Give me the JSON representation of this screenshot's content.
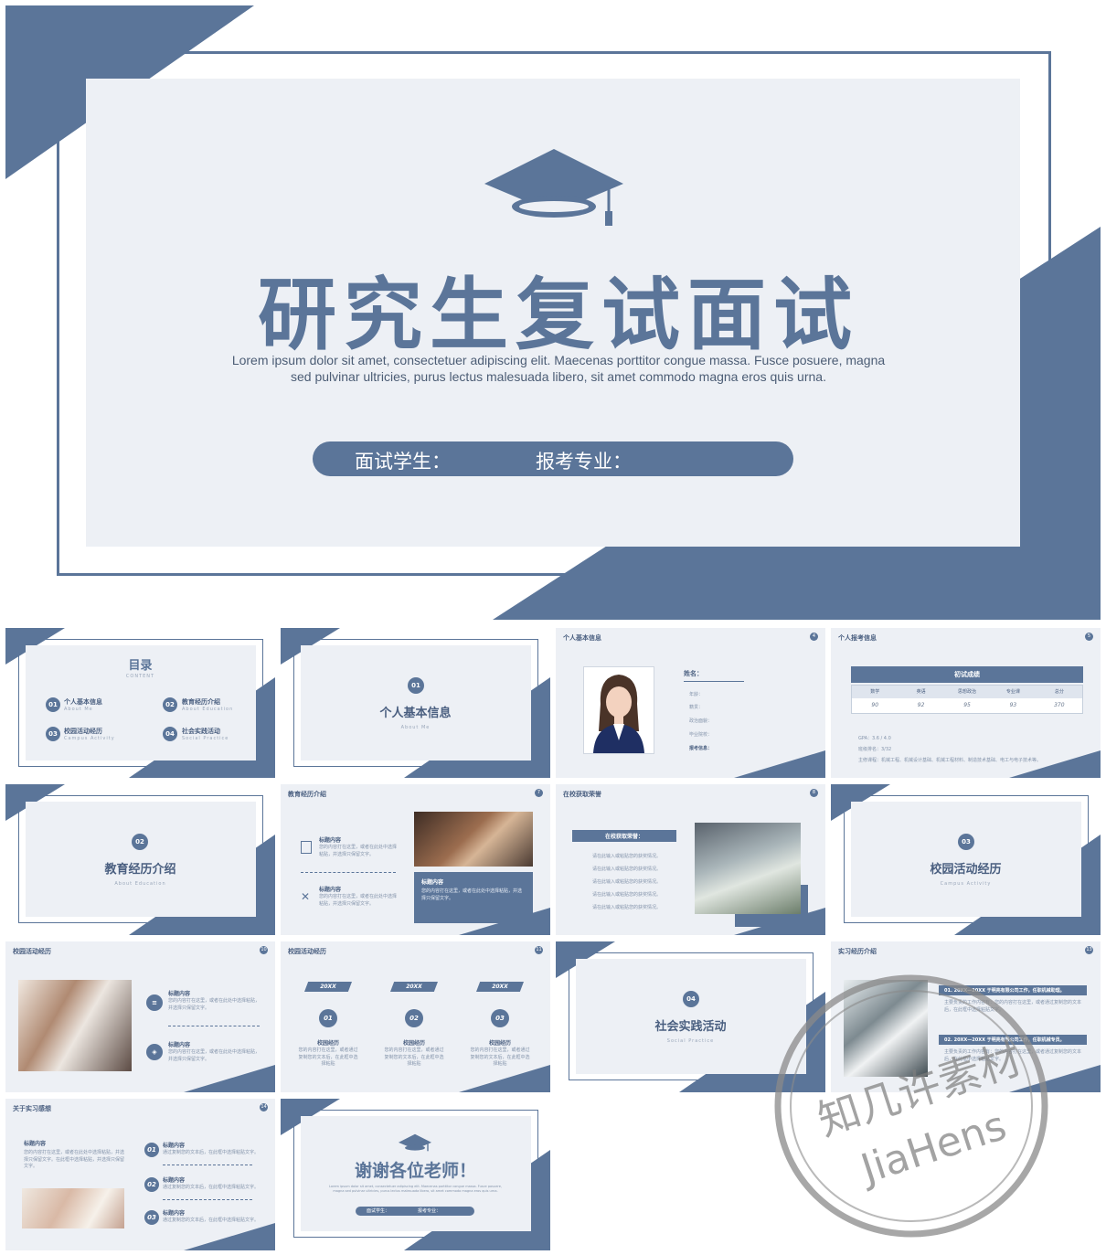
{
  "main": {
    "title": "研究生复试面试",
    "subtitle_line1": "Lorem ipsum dolor sit amet, consectetuer adipiscing elit. Maecenas porttitor congue massa. Fusce posuere, magna",
    "subtitle_line2": "sed pulvinar ultricies, purus lectus malesuada libero, sit amet commodo magna eros quis urna.",
    "student_label": "面试学生：",
    "major_label": "报考专业："
  },
  "toc": {
    "title": "目录",
    "subtitle": "CONTENT",
    "items": [
      {
        "num": "01",
        "label": "个人基本信息",
        "en": "About Me"
      },
      {
        "num": "02",
        "label": "教育经历介绍",
        "en": "About Education"
      },
      {
        "num": "03",
        "label": "校园活动经历",
        "en": "Campus Activity"
      },
      {
        "num": "04",
        "label": "社会实践活动",
        "en": "Social Practice"
      }
    ]
  },
  "section1": {
    "num": "01",
    "title": "个人基本信息",
    "en": "About Me"
  },
  "section2": {
    "num": "02",
    "title": "教育经历介绍",
    "en": "About Education"
  },
  "section3": {
    "num": "03",
    "title": "校园活动经历",
    "en": "Campus Activity"
  },
  "section4": {
    "num": "04",
    "title": "社会实践活动",
    "en": "Social Practice"
  },
  "info": {
    "header": "个人基本信息",
    "page": "4",
    "name_label": "姓名：",
    "fields": [
      "年龄：",
      "籍贯：",
      "政治面貌：",
      "毕业院校：",
      "报考信息："
    ]
  },
  "scores": {
    "header": "个人报考信息",
    "page": "5",
    "table_title": "初试成绩",
    "columns": [
      "数学",
      "英语",
      "思想政治",
      "专业课",
      "总分"
    ],
    "values": [
      "90",
      "92",
      "95",
      "93",
      "370"
    ],
    "notes": [
      "GPA：3.6 / 4.0",
      "班级排名：3/32",
      "主修课程：机械工程、机械设计基础、机械工程材料、制造技术基础、电工与电子技术等。"
    ]
  },
  "edu": {
    "header": "教育经历介绍",
    "page": "7",
    "item_title": "标题内容",
    "item_text": "您的内容打在这里，或者在此处中选择粘贴，并选择只保留文字。"
  },
  "honors": {
    "header": "在校获取荣誉",
    "page": "8",
    "box_title": "在校获取荣誉：",
    "items": [
      "请在此输入或粘贴您的获奖情况。",
      "请在此输入或粘贴您的获奖情况。",
      "请在此输入或粘贴您的获奖情况。",
      "请在此输入或粘贴您的获奖情况。",
      "请在此输入或粘贴您的获奖情况。"
    ]
  },
  "campus1": {
    "header": "校园活动经历",
    "page": "10",
    "item_title": "标题内容",
    "item_text": "您的内容打在这里，或者在此处中选择粘贴，并选择只保留文字。"
  },
  "campus2": {
    "header": "校园活动经历",
    "page": "11",
    "years": [
      "20XX",
      "20XX",
      "20XX"
    ],
    "nums": [
      "01",
      "02",
      "03"
    ],
    "labels": [
      "校园经历",
      "校园经历",
      "校园经历"
    ],
    "text": "您的内容打在这里，或者通过复制您的文本后，在此框中选择粘贴"
  },
  "intern": {
    "header": "实习经历介绍",
    "page": "13",
    "item1": "01. 20XX—20XX 于明亮有限公司工作，任职机械助理。",
    "item2": "02. 20XX—20XX 于明亮有限公司工作，任职机械专员。",
    "text": "主要负责的工作内容有：您的内容打在这里，或者通过复制您的文本后，在此框中选择粘贴文字。"
  },
  "reflect": {
    "header": "关于实习感想",
    "page": "14",
    "left_title": "标题内容",
    "left_text": "您的内容打在这里，或者在此处中选择粘贴，并选择只保留文字。在此框中选择粘贴，并选择只保留文字。",
    "nums": [
      "01",
      "02",
      "03"
    ],
    "item_title": "标题内容",
    "item_text": "通过复制您的文本后，在此框中选择粘贴文字。"
  },
  "thanks": {
    "title": "谢谢各位老师！",
    "text": "Lorem ipsum dolor sit amet, consectetuer adipiscing elit. Maecenas porttitor congue massa. Fusce posuere, magna sed pulvinar ultricies, purus lectus malesuada libero, sit amet commodo magna eros quis urna.",
    "student_label": "面试学生：",
    "major_label": "报考专业："
  },
  "watermark": {
    "line1": "知几许素材",
    "line2": "JiaHens"
  }
}
